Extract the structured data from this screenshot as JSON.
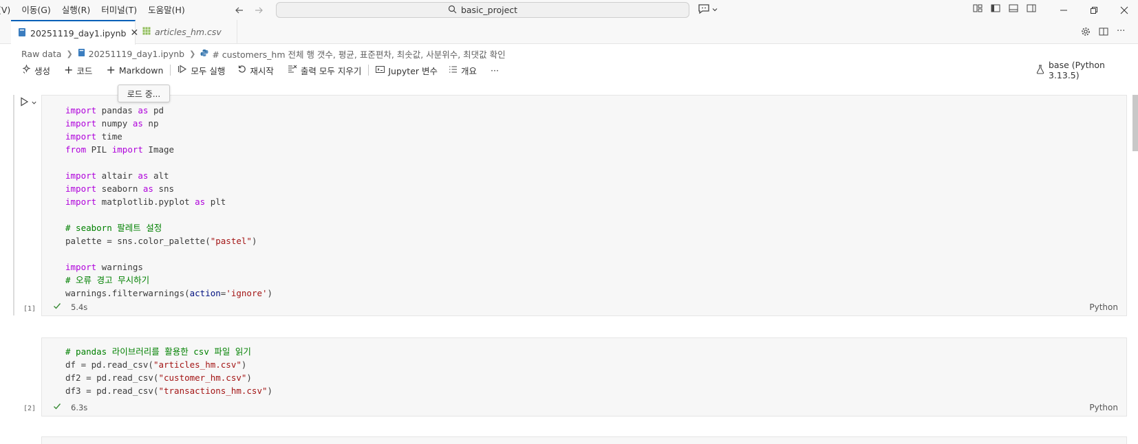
{
  "menu": [
    "(V)",
    "이동(G)",
    "실행(R)",
    "터미널(T)",
    "도움말(H)"
  ],
  "search": {
    "text": "basic_project"
  },
  "tabs": [
    {
      "label": "20251119_day1.ipynb",
      "active": true
    },
    {
      "label": "articles_hm.csv",
      "active": false
    }
  ],
  "breadcrumb": {
    "root": "Raw data",
    "file": "20251119_day1.ipynb",
    "cell": "# customers_hm 전체 행 갯수, 평균, 표준편차, 최솟값, 사분위수, 최댓값 확인"
  },
  "toolbar": {
    "generate": "생성",
    "code": "코드",
    "markdown": "Markdown",
    "run_all": "모두 실행",
    "restart": "재시작",
    "clear_outputs": "출력 모두 지우기",
    "jupyter_vars": "Jupyter 변수",
    "outline": "개요",
    "more": "···"
  },
  "kernel": "base (Python 3.13.5)",
  "tooltip": "로드 중...",
  "cells": [
    {
      "exec": "[1]",
      "duration": "5.4s",
      "lang": "Python"
    },
    {
      "exec": "[2]",
      "duration": "6.3s",
      "lang": "Python"
    }
  ],
  "code1": [
    "import",
    " pandas ",
    "as",
    " pd",
    "import",
    " numpy ",
    "as",
    " np",
    "import",
    " time",
    "from",
    " PIL ",
    "import",
    " Image",
    "import",
    " altair ",
    "as",
    " alt",
    "import",
    " seaborn ",
    "as",
    " sns",
    "import",
    " matplotlib.pyplot ",
    "as",
    " plt",
    "# seaborn 팔레트 설정",
    "palette = sns.color_palette(",
    "\"pastel\"",
    ")",
    "import",
    " warnings",
    "# 오류 경고 무시하기",
    "warnings.filterwarnings(",
    "action",
    "=",
    "'ignore'",
    ")"
  ],
  "code2": [
    "# pandas 라이브러리를 활용한 csv 파일 읽기",
    "df = pd.read_csv(",
    "\"articles_hm.csv\"",
    ")",
    "df2 = pd.read_csv(",
    "\"customer_hm.csv\"",
    ")",
    "df3 = pd.read_csv(",
    "\"transactions_hm.csv\"",
    ")"
  ],
  "colors": {
    "accent": "#005fb8",
    "keyword": "#af00db",
    "string": "#a31515",
    "comment": "#008000",
    "success": "#388a34"
  }
}
